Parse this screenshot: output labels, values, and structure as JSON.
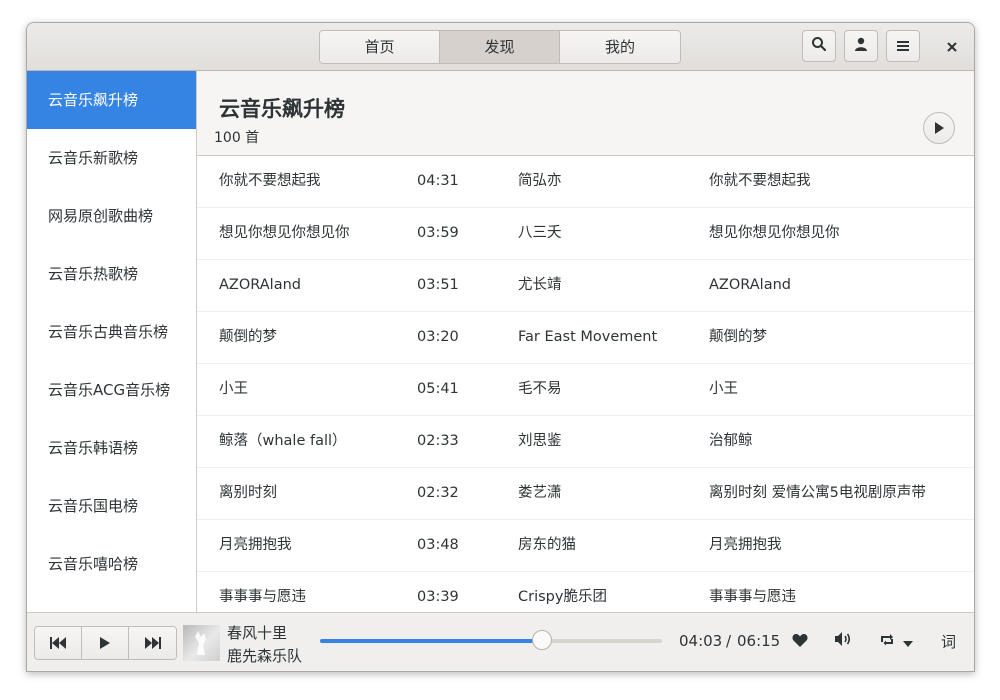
{
  "header": {
    "tabs": [
      {
        "label": "首页"
      },
      {
        "label": "发现"
      },
      {
        "label": "我的"
      }
    ],
    "active_tab": 1
  },
  "sidebar": {
    "items": [
      {
        "label": "云音乐飙升榜"
      },
      {
        "label": "云音乐新歌榜"
      },
      {
        "label": "网易原创歌曲榜"
      },
      {
        "label": "云音乐热歌榜"
      },
      {
        "label": "云音乐古典音乐榜"
      },
      {
        "label": "云音乐ACG音乐榜"
      },
      {
        "label": "云音乐韩语榜"
      },
      {
        "label": "云音乐国电榜"
      },
      {
        "label": "云音乐嘻哈榜"
      }
    ],
    "active_index": 0
  },
  "playlist": {
    "title": "云音乐飙升榜",
    "count": "100 首",
    "songs": [
      {
        "name": "你就不要想起我",
        "duration": "04:31",
        "artist": "简弘亦",
        "album": "你就不要想起我"
      },
      {
        "name": "想见你想见你想见你",
        "duration": "03:59",
        "artist": "八三夭",
        "album": "想见你想见你想见你"
      },
      {
        "name": "AZORAland",
        "duration": "03:51",
        "artist": "尤长靖",
        "album": "AZORAland"
      },
      {
        "name": "颠倒的梦",
        "duration": "03:20",
        "artist": "Far East Movement",
        "album": "颠倒的梦"
      },
      {
        "name": "小王",
        "duration": "05:41",
        "artist": "毛不易",
        "album": "小王"
      },
      {
        "name": "鲸落（whale fall）",
        "duration": "02:33",
        "artist": "刘思鉴",
        "album": "治郁鲸"
      },
      {
        "name": "离别时刻",
        "duration": "02:32",
        "artist": "娄艺潇",
        "album": "离别时刻 爱情公寓5电视剧原声带"
      },
      {
        "name": "月亮拥抱我",
        "duration": "03:48",
        "artist": "房东的猫",
        "album": "月亮拥抱我"
      },
      {
        "name": "事事事与愿违",
        "duration": "03:39",
        "artist": "Crispy脆乐团",
        "album": "事事事与愿违"
      }
    ]
  },
  "player": {
    "title": "春风十里",
    "artist": "鹿先森乐队",
    "current_time": "04:03",
    "separator": "/",
    "total_time": "06:15",
    "progress": 0.648,
    "lyrics_label": "词"
  },
  "colors": {
    "accent": "#3584e4",
    "text": "#2e3436"
  }
}
